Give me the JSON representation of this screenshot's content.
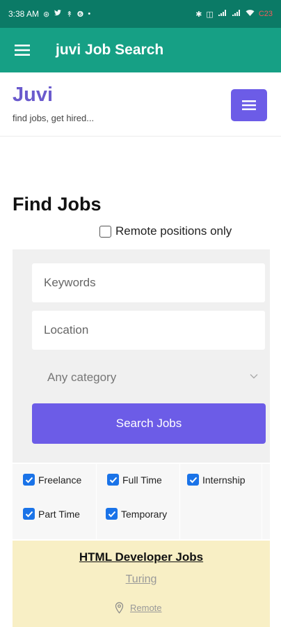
{
  "status_bar": {
    "time": "3:38 AM",
    "left_icons": [
      "sync-icon",
      "twitter-icon",
      "usb-icon",
      "badge-6-icon",
      "dot-icon"
    ],
    "right_icons": [
      "bluetooth-icon",
      "vibrate-icon",
      "signal-icon",
      "signal-icon-2",
      "wifi-icon",
      "battery-icon"
    ],
    "battery_label": "C23"
  },
  "app_bar": {
    "title": "juvi Job Search"
  },
  "site": {
    "brand": "Juvi",
    "tagline": "find jobs, get hired..."
  },
  "search": {
    "title": "Find Jobs",
    "remote_label": "Remote positions only",
    "remote_checked": false,
    "keywords_placeholder": "Keywords",
    "location_placeholder": "Location",
    "category_selected": "Any category",
    "button_label": "Search Jobs"
  },
  "job_types": [
    {
      "label": "Freelance",
      "checked": true
    },
    {
      "label": "Full Time",
      "checked": true
    },
    {
      "label": "Internship",
      "checked": true
    },
    {
      "label": "Part Time",
      "checked": true
    },
    {
      "label": "Temporary",
      "checked": true
    }
  ],
  "job": {
    "title": "HTML Developer Jobs",
    "company": "Turing",
    "location": "Remote"
  },
  "colors": {
    "status_bar": "#0b7a66",
    "app_bar": "#16a085",
    "accent": "#6c5ce7",
    "brand": "#6a5acd",
    "checkbox": "#1a73e8",
    "job_card": "#f8efc5"
  }
}
